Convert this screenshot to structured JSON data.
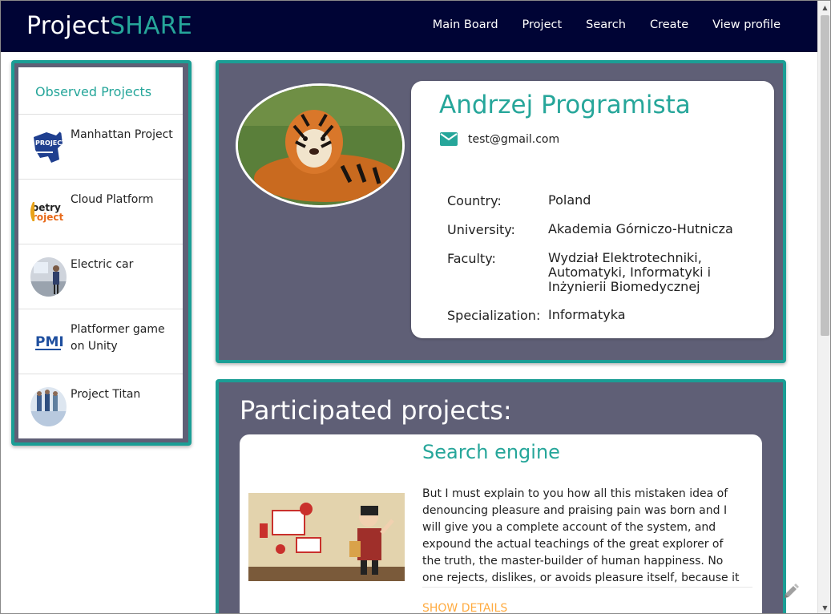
{
  "navbar": {
    "brand_main": "Project",
    "brand_accent": "SHARE",
    "links": [
      "Main Board",
      "Project",
      "Search",
      "Create",
      "View profile"
    ]
  },
  "sidebar": {
    "title": "Observed Projects",
    "projects": [
      {
        "name": "Manhattan Project",
        "thumb": "project-logo-map"
      },
      {
        "name": "Cloud Platform",
        "thumb": "poetry-project-logo"
      },
      {
        "name": "Electric car",
        "thumb": "person-presenting-photo"
      },
      {
        "name": "Platformer game on Unity",
        "thumb": "pmi-logo"
      },
      {
        "name": "Project Titan",
        "thumb": "meeting-photo"
      }
    ]
  },
  "profile": {
    "name": "Andrzej Programista",
    "email": "test@gmail.com",
    "avatar": "tiger-photo",
    "details": [
      {
        "label": "Country:",
        "value": "Poland"
      },
      {
        "label": "University:",
        "value": "Akademia Górniczo-Hutnicza"
      },
      {
        "label": "Faculty:",
        "value": "Wydział Elektrotechniki, Automatyki, Informatyki i Inżynierii Biomedycznej"
      },
      {
        "label": "Specialization:",
        "value": "Informatyka"
      }
    ]
  },
  "participated": {
    "title": "Participated projects:",
    "projects": [
      {
        "title": "Search engine",
        "image": "woman-presenting-illustration",
        "description": "But I must explain to you how all this mistaken idea of denouncing pleasure and praising pain was born and I will give you a complete account of the system, and expound the actual teachings of the great explorer of the truth, the master-builder of human happiness. No one rejects, dislikes, or avoids pleasure itself, because it is pleasure, but",
        "link": "SHOW DETAILS"
      }
    ]
  },
  "colors": {
    "navbar": "#000435",
    "accent": "#26a69a",
    "border": "#1b9e95",
    "panel": "#5f5f76",
    "link": "#ffab40"
  }
}
